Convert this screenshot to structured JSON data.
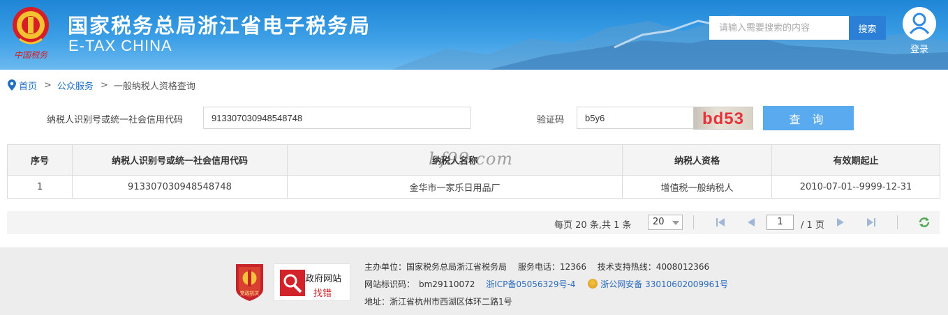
{
  "header": {
    "title": "国家税务总局浙江省电子税务局",
    "subtitle": "E-TAX CHINA",
    "emblem_text": "中国税务",
    "search_placeholder": "请输入需要搜索的内容",
    "search_button": "搜索",
    "login_label": "登录"
  },
  "breadcrumb": {
    "items": [
      "首页",
      "公众服务",
      "一般纳税人资格查询"
    ],
    "separator": ">"
  },
  "form": {
    "taxid_label": "纳税人识别号或统一社会信用代码",
    "taxid_value": "913307030948548748",
    "captcha_label": "验证码",
    "captcha_value": "b5y6",
    "captcha_image_text": "bd53",
    "query_button": "查 询"
  },
  "table": {
    "watermark": "bf99.com",
    "columns": [
      "序号",
      "纳税人识别号或统一社会信用代码",
      "纳税人名称",
      "纳税人资格",
      "有效期起止"
    ],
    "rows": [
      [
        "1",
        "913307030948548748",
        "金华市一家乐日用品厂",
        "增值税一般纳税人",
        "2010-07-01--9999-12-31"
      ]
    ]
  },
  "pagination": {
    "info": "每页 20 条,共 1 条",
    "page_size": "20",
    "current_page": "1",
    "total_pages": "/ 1 页"
  },
  "footer": {
    "party_logo_text": "党政机关",
    "gov_site_top": "政府网站",
    "gov_site_bottom": "找错",
    "line1": "主办单位：国家税务总局浙江省税务局　 服务电话：12366　 技术支持热线：4008012366",
    "site_id": "网站标识码：　bm29110072",
    "icp": "浙ICP备05056329号-4",
    "police": "浙公网安备 33010602009961号",
    "address": "地址：浙江省杭州市西湖区体环二路1号"
  },
  "colors": {
    "header_blue": "#1f86d6",
    "link_blue": "#1f6fc5",
    "query_button": "#5aaaf0",
    "captcha_red": "#e8323a"
  }
}
